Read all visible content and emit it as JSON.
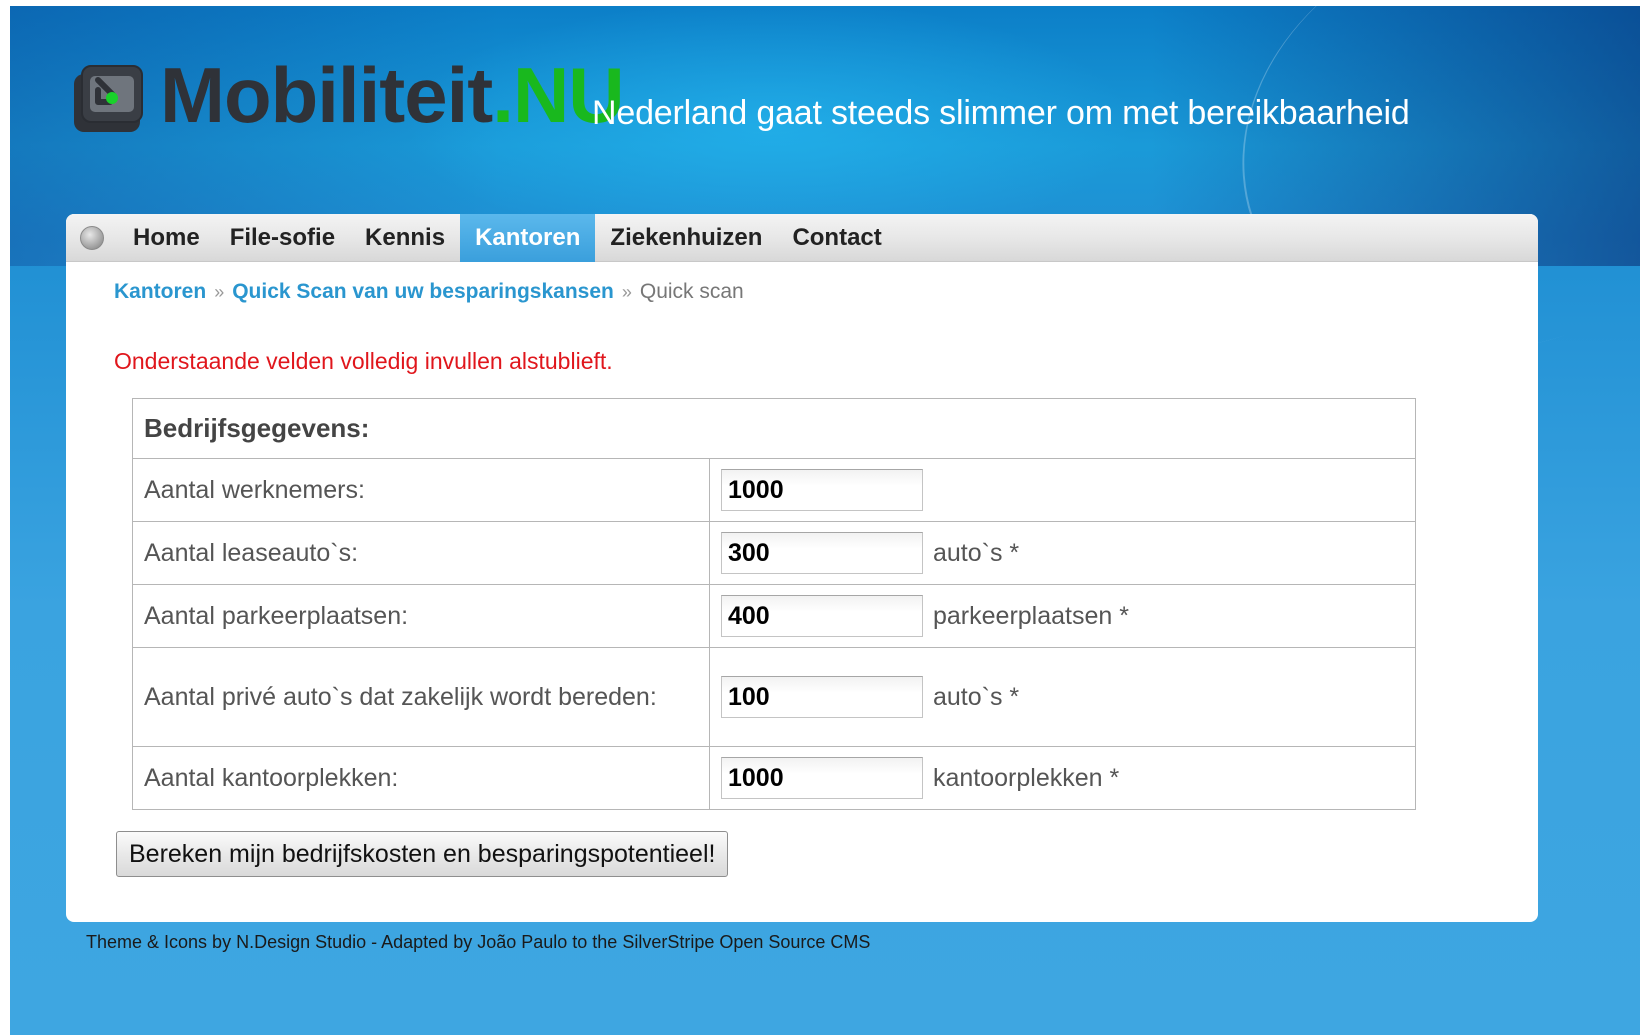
{
  "header": {
    "logo_word": "Mobiliteit",
    "logo_dot": ".",
    "logo_suffix": "NU",
    "tagline": "Nederland gaat steeds slimmer om met bereikbaarheid"
  },
  "nav": {
    "items": [
      {
        "label": "Home"
      },
      {
        "label": "File-sofie"
      },
      {
        "label": "Kennis"
      },
      {
        "label": "Kantoren"
      },
      {
        "label": "Ziekenhuizen"
      },
      {
        "label": "Contact"
      }
    ],
    "active": "Kantoren"
  },
  "breadcrumb": {
    "items": [
      "Kantoren",
      "Quick Scan van uw besparingskansen"
    ],
    "separator": "»",
    "current": "Quick scan"
  },
  "notice": "Onderstaande velden volledig invullen alstublieft.",
  "form": {
    "section_title": "Bedrijfsgegevens:",
    "rows": [
      {
        "label": "Aantal werknemers:",
        "value": "1000",
        "unit": ""
      },
      {
        "label": "Aantal leaseauto`s:",
        "value": "300",
        "unit": "auto`s *"
      },
      {
        "label": "Aantal parkeerplaatsen:",
        "value": "400",
        "unit": "parkeerplaatsen *"
      },
      {
        "label": "Aantal privé auto`s dat zakelijk wordt bereden:",
        "value": "100",
        "unit": "auto`s *"
      },
      {
        "label": "Aantal kantoorplekken:",
        "value": "1000",
        "unit": "kantoorplekken *"
      }
    ],
    "submit_label": "Bereken mijn bedrijfskosten en besparingspotentieel!"
  },
  "footer": "Theme & Icons by N.Design Studio - Adapted by João Paulo to the SilverStripe Open Source CMS",
  "colors": {
    "accent_blue": "#2a96cf",
    "brand_green": "#19b81e",
    "notice_red": "#e0161c",
    "nav_active": "#3a9fdc"
  }
}
